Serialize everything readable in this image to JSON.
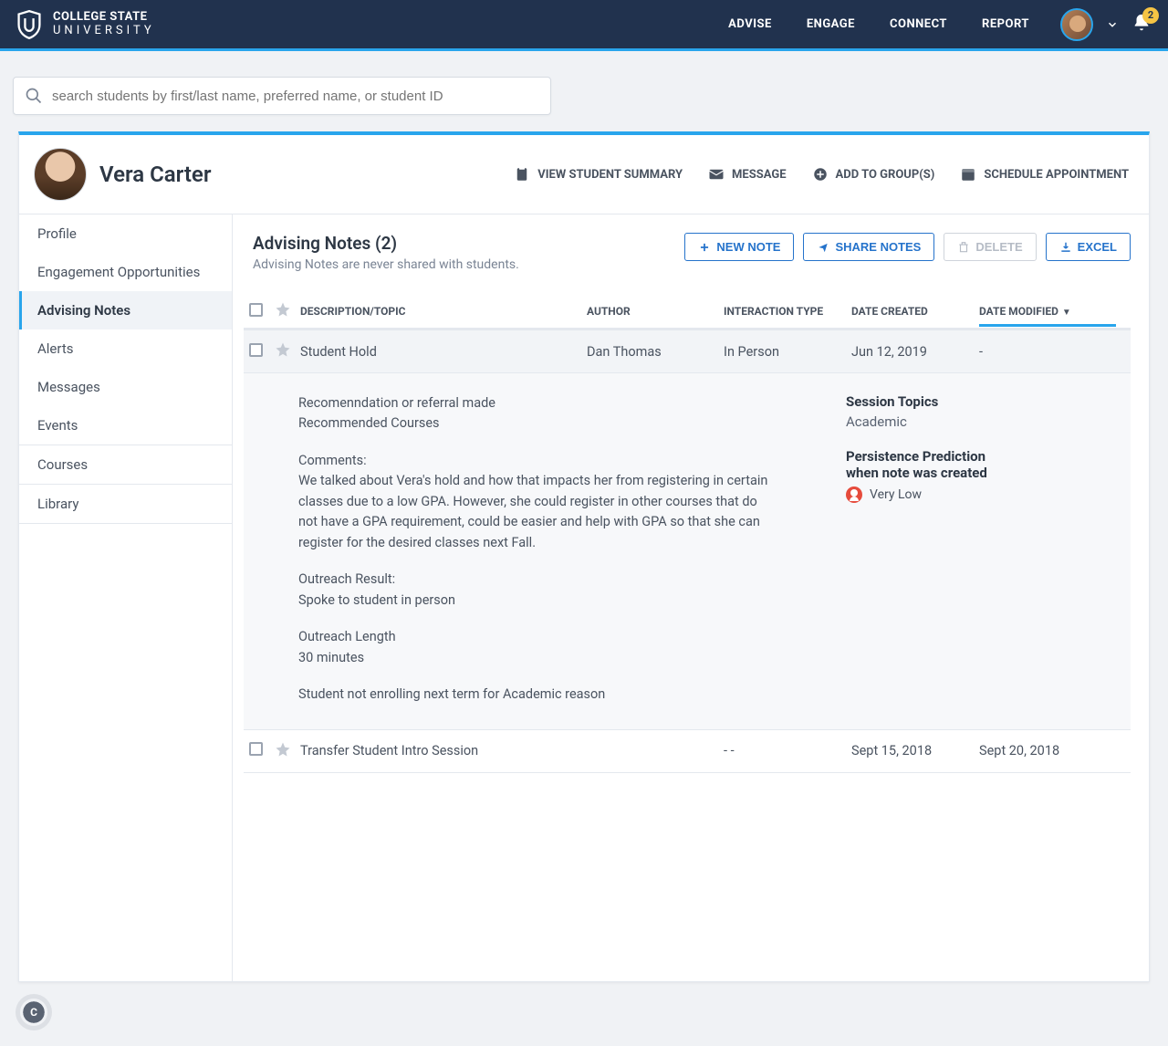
{
  "brand": {
    "line1": "COLLEGE STATE",
    "line2": "UNIVERSITY"
  },
  "nav": {
    "items": [
      "ADVISE",
      "ENGAGE",
      "CONNECT",
      "REPORT"
    ],
    "badge_count": "2"
  },
  "search": {
    "placeholder": "search students by first/last name, preferred name, or student ID"
  },
  "student": {
    "name": "Vera Carter"
  },
  "header_actions": {
    "summary": "VIEW STUDENT SUMMARY",
    "message": "MESSAGE",
    "groups": "ADD TO GROUP(S)",
    "schedule": "SCHEDULE APPOINTMENT"
  },
  "sidebar": {
    "items": [
      {
        "label": "Profile"
      },
      {
        "label": "Engagement Opportunities"
      },
      {
        "label": "Advising Notes"
      },
      {
        "label": "Alerts"
      },
      {
        "label": "Messages"
      },
      {
        "label": "Events"
      },
      {
        "label": "Courses"
      },
      {
        "label": "Library"
      }
    ]
  },
  "panel": {
    "title": "Advising Notes (2)",
    "subtitle": "Advising Notes are never shared with students.",
    "buttons": {
      "new": "NEW NOTE",
      "share": "SHARE NOTES",
      "delete": "DELETE",
      "excel": "EXCEL"
    }
  },
  "columns": {
    "desc": "DESCRIPTION/TOPIC",
    "author": "AUTHOR",
    "interaction": "INTERACTION TYPE",
    "created": "DATE CREATED",
    "modified": "DATE MODIFIED"
  },
  "rows": [
    {
      "desc": "Student Hold",
      "author": "Dan Thomas",
      "interaction": "In Person",
      "created": "Jun 12, 2019",
      "modified": "-"
    },
    {
      "desc": "Transfer Student Intro Session",
      "author": "",
      "interaction": "- -",
      "created": "Sept 15, 2018",
      "modified": "Sept 20, 2018"
    }
  ],
  "note": {
    "l1": "Recomenndation or referral made",
    "l2": "Recommended Courses",
    "l3": "Comments:",
    "l4": "We talked about Vera's hold and how that impacts her from registering in certain classes due to a low GPA. However, she could register in other courses that do not have a GPA requirement, could be easier and help with GPA so that she can register for the desired classes next Fall.",
    "l5": "Outreach Result:",
    "l6": "Spoke to student in person",
    "l7": "Outreach Length",
    "l8": "30 minutes",
    "l9": "Student not enrolling next term for Academic reason",
    "topics_title": "Session Topics",
    "topics_value": "Academic",
    "pp_title1": "Persistence Prediction",
    "pp_title2": "when note was created",
    "pp_value": "Very Low"
  },
  "corner": "C"
}
